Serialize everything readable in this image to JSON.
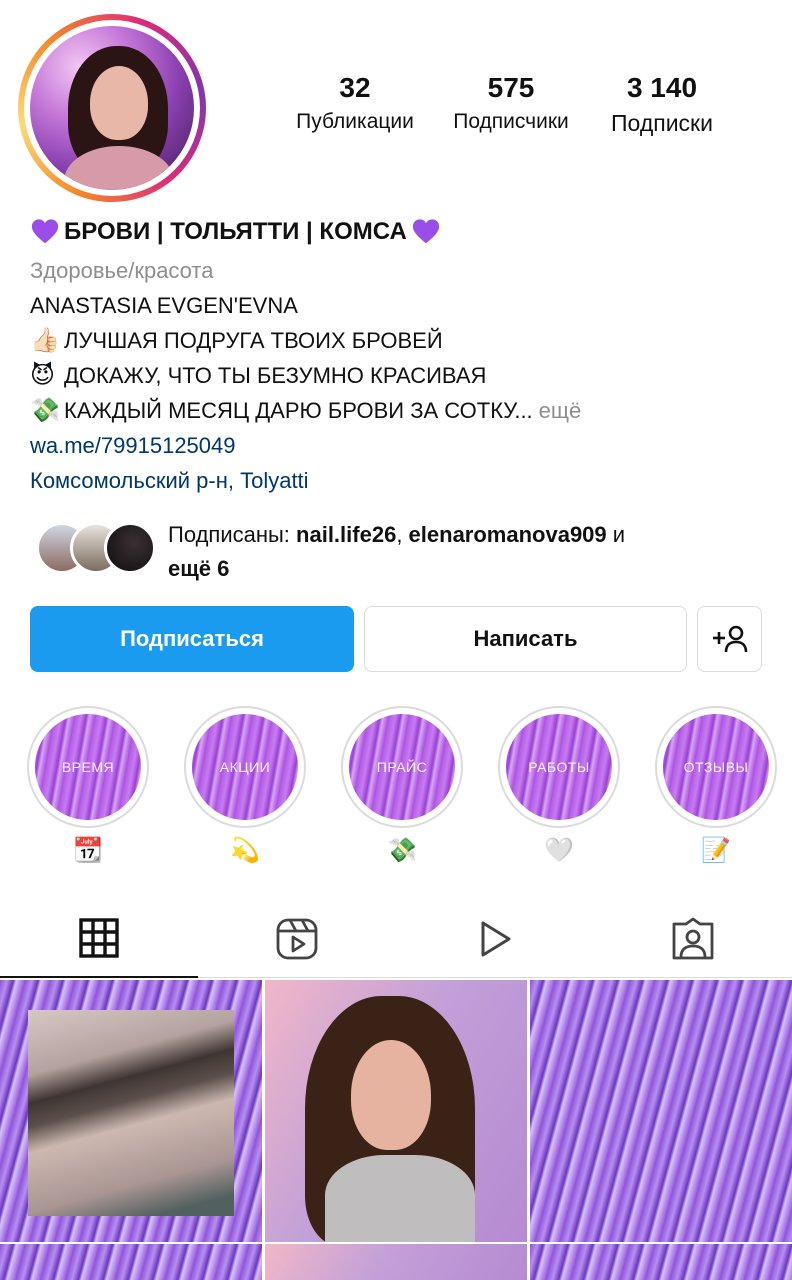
{
  "profile": {
    "stats": [
      {
        "value": "32",
        "label": "Публикации"
      },
      {
        "value": "575",
        "label": "Подписчики"
      },
      {
        "value": "3 140",
        "label": "Подписки"
      }
    ],
    "name": "БРОВИ | ТОЛЬЯТТИ | КОМСА",
    "category": "Здоровье/красота",
    "bio": [
      {
        "emoji": "",
        "text": "ANASTASIA EVGEN'EVNA"
      },
      {
        "emoji": "👍🏻",
        "text": "ЛУЧШАЯ ПОДРУГА ТВОИХ БРОВЕЙ"
      },
      {
        "emoji": "😈",
        "text": "ДОКАЖУ, ЧТО ТЫ БЕЗУМНО КРАСИВАЯ"
      },
      {
        "emoji": "💸",
        "text": "КАЖДЫЙ МЕСЯЦ ДАРЮ БРОВИ ЗА СОТКУ..."
      }
    ],
    "more_label": "ещё",
    "link": "wa.me/79915125049",
    "location": "Комсомольский р-н, Tolyatti"
  },
  "followed_by": {
    "prefix": "Подписаны: ",
    "user1": "nail.life26",
    "sep": ", ",
    "user2": "elenaromanova909",
    "and": " и",
    "rest": "ещё 6"
  },
  "buttons": {
    "follow": "Подписаться",
    "message": "Написать"
  },
  "highlights": [
    {
      "title": "ВРЕМЯ",
      "emoji": "📆"
    },
    {
      "title": "АКЦИИ",
      "emoji": "💫"
    },
    {
      "title": "ПРАЙС",
      "emoji": "💸"
    },
    {
      "title": "РАБОТЫ",
      "emoji": "🤍"
    },
    {
      "title": "ОТЗЫВЫ",
      "emoji": "📝"
    }
  ],
  "colors": {
    "accent": "#1a9bf0",
    "link": "#00376b",
    "muted": "#8e8e8e",
    "heart": "#9b4dea"
  },
  "tabs": [
    "grid-icon",
    "reels-icon",
    "video-icon",
    "tagged-icon"
  ]
}
